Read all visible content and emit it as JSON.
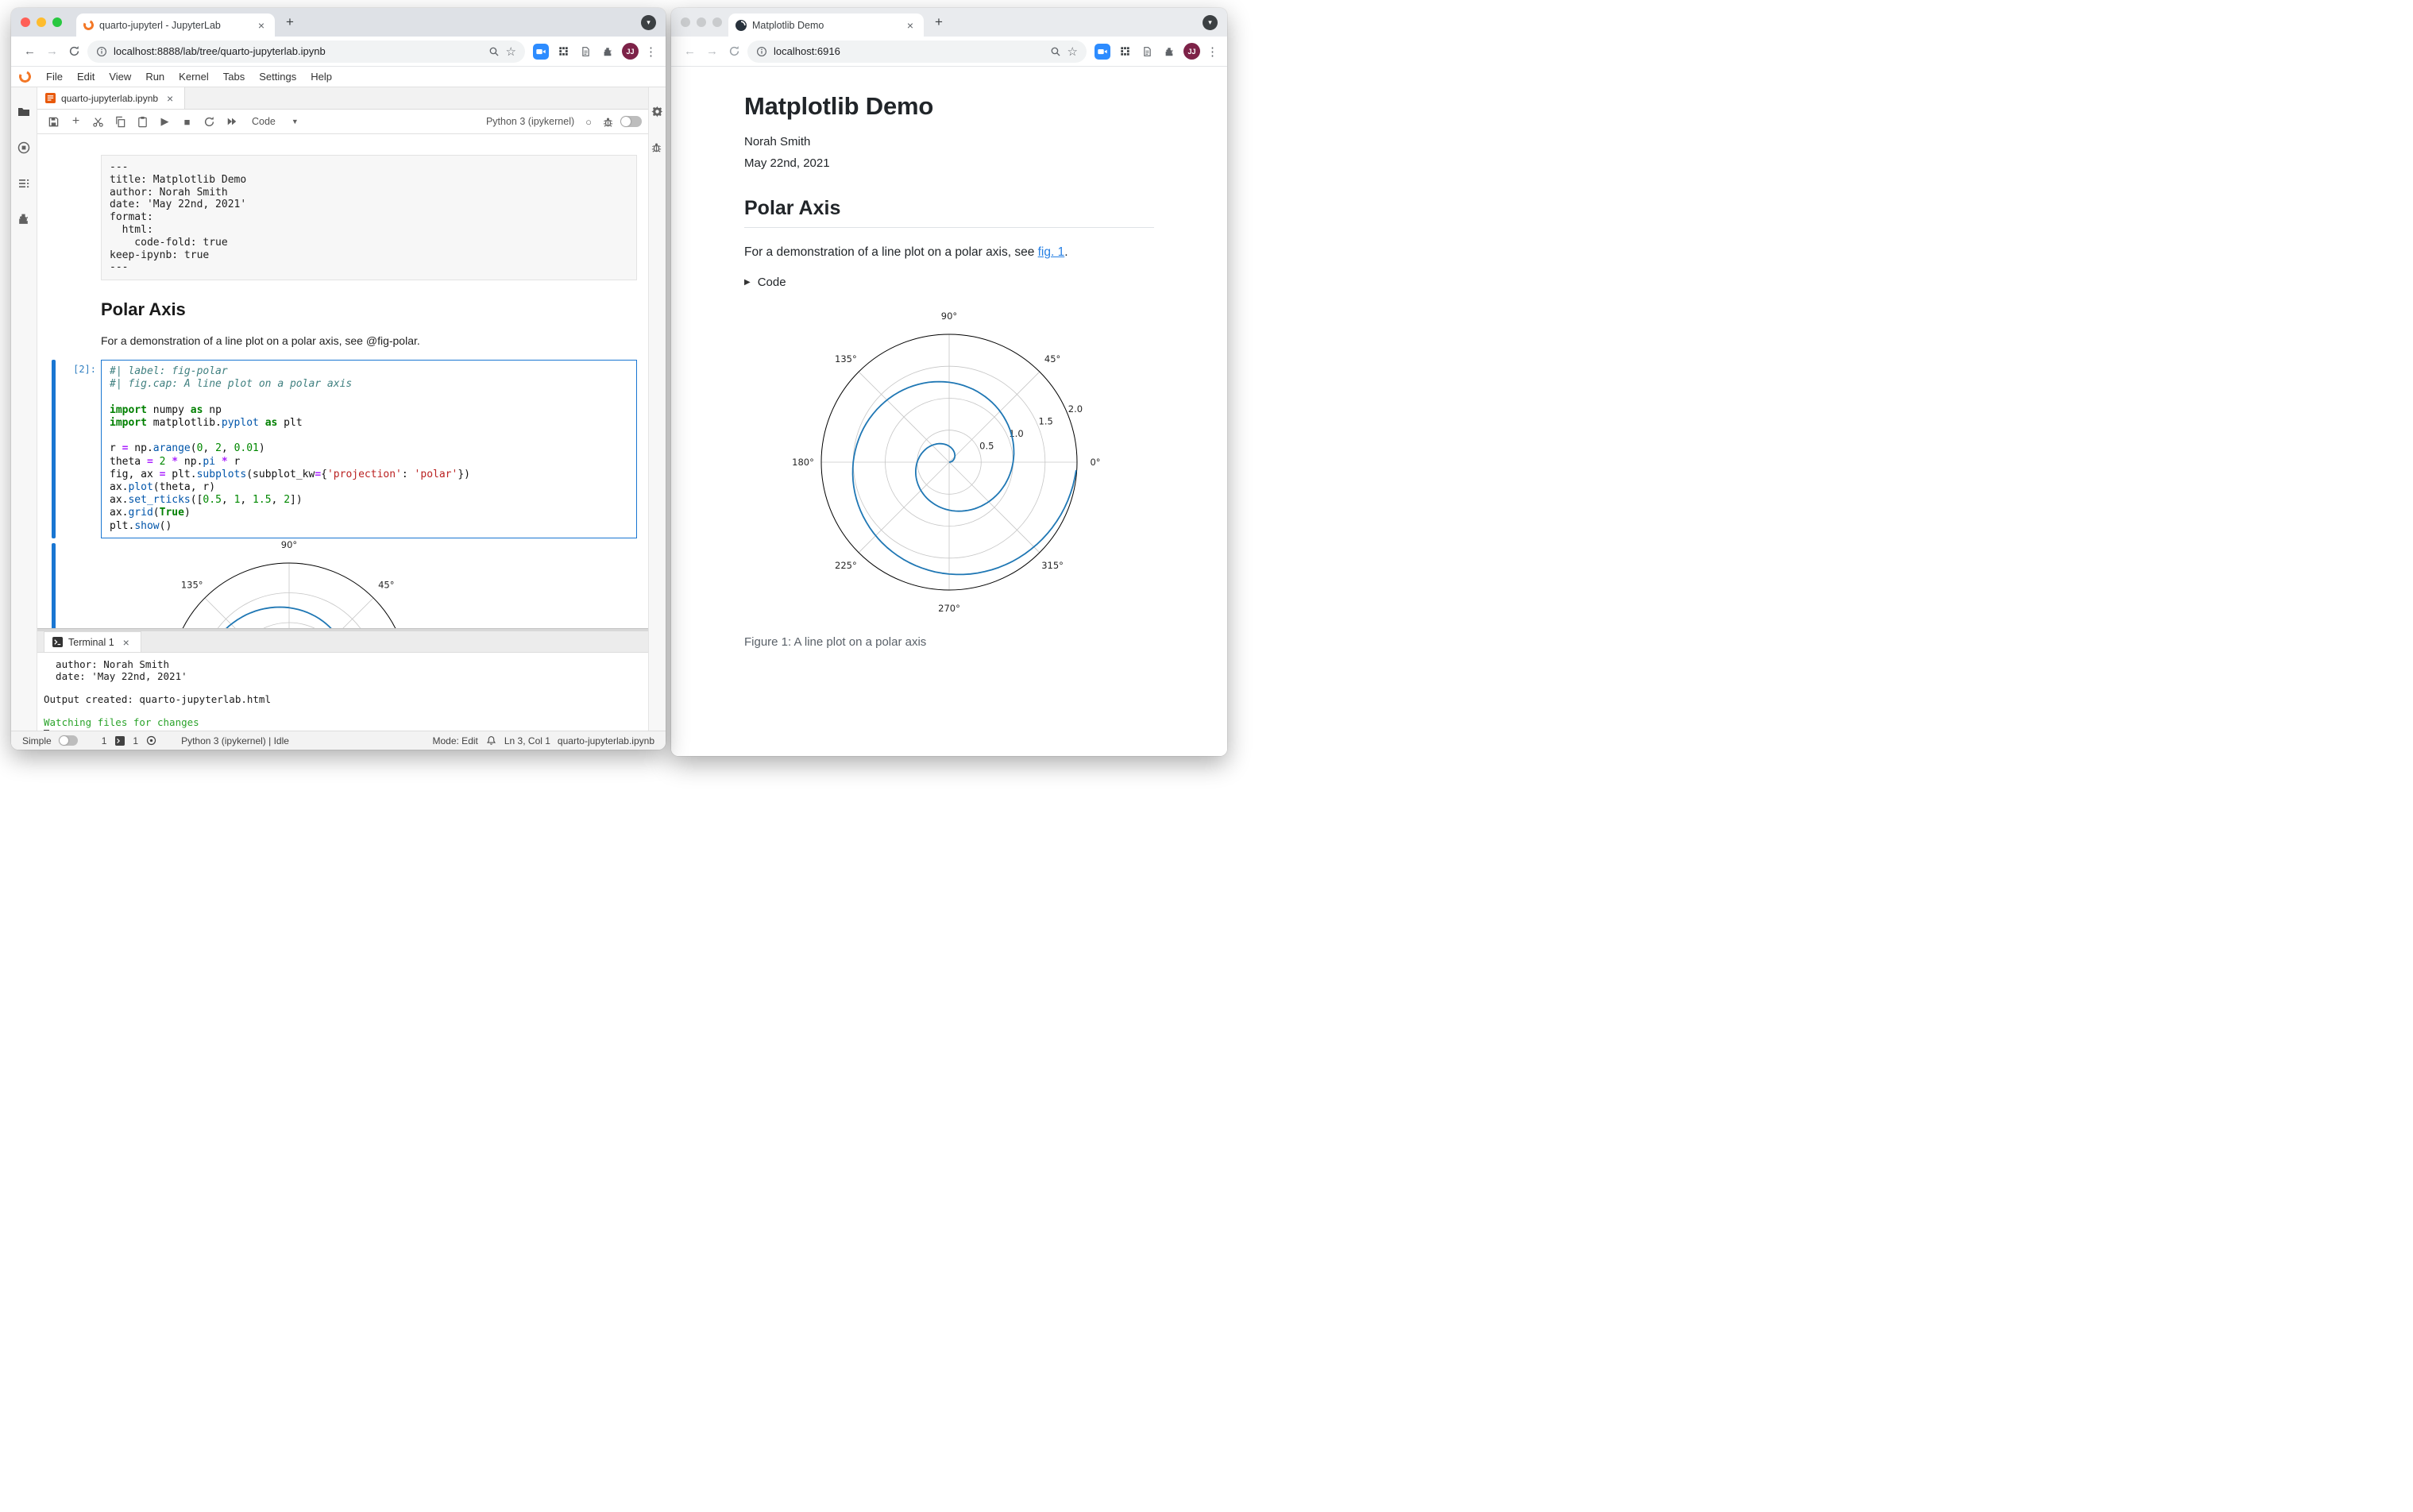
{
  "colors": {
    "jupyter_orange": "#f37726",
    "matplotlib_line_blue": "#1f77b4",
    "active_cell_border_blue": "#1976d2",
    "prompt_blue": "#307fc1",
    "link_blue": "#2780e3",
    "terminal_green": "#2aa32a",
    "avatar_maroon": "#7d2248",
    "zoom_extension_blue": "#2d8cff",
    "traffic_red": "#ff5f57",
    "traffic_yellow": "#febc2e",
    "traffic_green": "#28c840"
  },
  "left_window": {
    "browser": {
      "tab_title": "quarto-jupyterl - JupyterLab",
      "url": "localhost:8888/lab/tree/quarto-jupyterlab.ipynb",
      "new_tab_label": "+",
      "avatar_initials": "JJ"
    },
    "jupyterlab": {
      "menu": [
        "File",
        "Edit",
        "View",
        "Run",
        "Kernel",
        "Tabs",
        "Settings",
        "Help"
      ],
      "document_tab": "quarto-jupyterlab.ipynb",
      "toolbar": {
        "cell_type_selector": "Code",
        "kernel_name": "Python 3 (ipykernel)"
      },
      "raw_cell": {
        "lines": [
          "---",
          "title: Matplotlib Demo",
          "author: Norah Smith",
          "date: 'May 22nd, 2021'",
          "format:",
          "  html:",
          "    code-fold: true",
          "keep-ipynb: true",
          "---"
        ]
      },
      "markdown_cell": {
        "heading": "Polar Axis",
        "paragraph": "For a demonstration of a line plot on a polar axis, see @fig-polar."
      },
      "code_cell": {
        "prompt": "[2]:",
        "token_lines": [
          [
            [
              "c",
              "#| label: fig-polar"
            ]
          ],
          [
            [
              "c",
              "#| fig.cap: A line plot on a polar axis"
            ]
          ],
          [],
          [
            [
              "k",
              "import"
            ],
            [
              "p",
              " numpy "
            ],
            [
              "k",
              "as"
            ],
            [
              "p",
              " np"
            ]
          ],
          [
            [
              "k",
              "import"
            ],
            [
              "p",
              " matplotlib."
            ],
            [
              "f",
              "pyplot"
            ],
            [
              "p",
              " "
            ],
            [
              "k",
              "as"
            ],
            [
              "p",
              " plt"
            ]
          ],
          [],
          [
            [
              "p",
              "r "
            ],
            [
              "o",
              "="
            ],
            [
              "p",
              " np."
            ],
            [
              "f",
              "arange"
            ],
            [
              "p",
              "("
            ],
            [
              "n",
              "0"
            ],
            [
              "p",
              ", "
            ],
            [
              "n",
              "2"
            ],
            [
              "p",
              ", "
            ],
            [
              "n",
              "0.01"
            ],
            [
              "p",
              ")"
            ]
          ],
          [
            [
              "p",
              "theta "
            ],
            [
              "o",
              "="
            ],
            [
              "p",
              " "
            ],
            [
              "n",
              "2"
            ],
            [
              "p",
              " "
            ],
            [
              "o",
              "*"
            ],
            [
              "p",
              " np."
            ],
            [
              "f",
              "pi"
            ],
            [
              "p",
              " "
            ],
            [
              "o",
              "*"
            ],
            [
              "p",
              " r"
            ]
          ],
          [
            [
              "p",
              "fig, ax "
            ],
            [
              "o",
              "="
            ],
            [
              "p",
              " plt."
            ],
            [
              "f",
              "subplots"
            ],
            [
              "p",
              "(subplot_kw"
            ],
            [
              "o",
              "="
            ],
            [
              "p",
              "{"
            ],
            [
              "s",
              "'projection'"
            ],
            [
              "p",
              ": "
            ],
            [
              "s",
              "'polar'"
            ],
            [
              "p",
              "})"
            ]
          ],
          [
            [
              "p",
              "ax."
            ],
            [
              "f",
              "plot"
            ],
            [
              "p",
              "(theta, r)"
            ]
          ],
          [
            [
              "p",
              "ax."
            ],
            [
              "f",
              "set_rticks"
            ],
            [
              "p",
              "(["
            ],
            [
              "n",
              "0.5"
            ],
            [
              "p",
              ", "
            ],
            [
              "n",
              "1"
            ],
            [
              "p",
              ", "
            ],
            [
              "n",
              "1.5"
            ],
            [
              "p",
              ", "
            ],
            [
              "n",
              "2"
            ],
            [
              "p",
              "])"
            ]
          ],
          [
            [
              "p",
              "ax."
            ],
            [
              "f",
              "grid"
            ],
            [
              "p",
              "("
            ],
            [
              "k",
              "True"
            ],
            [
              "p",
              ")"
            ]
          ],
          [
            [
              "p",
              "plt."
            ],
            [
              "f",
              "show"
            ],
            [
              "p",
              "()"
            ]
          ]
        ]
      },
      "terminal": {
        "tab_label": "Terminal 1",
        "lines": [
          {
            "text": "  author: Norah Smith"
          },
          {
            "text": "  date: 'May 22nd, 2021'"
          },
          {
            "text": ""
          },
          {
            "text": "Output created: quarto-jupyterlab.html"
          },
          {
            "text": ""
          },
          {
            "text": "Watching files for changes",
            "color": "green"
          }
        ]
      },
      "status_bar": {
        "mode_toggle_label": "Simple",
        "terminals_count": "1",
        "kernels_count": "1",
        "kernel_status": "Python 3 (ipykernel) | Idle",
        "mode": "Mode: Edit",
        "cursor_position": "Ln 3, Col 1",
        "file_name": "quarto-jupyterlab.ipynb"
      }
    }
  },
  "right_window": {
    "browser": {
      "tab_title": "Matplotlib Demo",
      "url": "localhost:6916",
      "new_tab_label": "+",
      "avatar_initials": "JJ"
    },
    "document": {
      "title": "Matplotlib Demo",
      "author": "Norah Smith",
      "date": "May 22nd, 2021",
      "section_heading": "Polar Axis",
      "paragraph_prefix": "For a demonstration of a line plot on a polar axis, see ",
      "figure_link": "fig. 1",
      "paragraph_suffix": ".",
      "code_fold_label": "Code",
      "figure_caption": "Figure 1: A line plot on a polar axis"
    }
  },
  "chart_data": {
    "type": "line",
    "projection": "polar",
    "description": "Archimedean spiral: theta = 2*pi*r for r in [0, 2) step 0.01",
    "series": [
      {
        "name": "spiral",
        "r_start": 0,
        "r_end": 2,
        "r_step": 0.01,
        "theta_formula": "theta = 2 * pi * r"
      }
    ],
    "rmax": 2.0,
    "rticks": [
      0.5,
      1.0,
      1.5,
      2.0
    ],
    "rtick_labels": [
      "0.5",
      "1.0",
      "1.5",
      "2.0"
    ],
    "theta_tick_labels": [
      "0°",
      "45°",
      "90°",
      "135°",
      "180°",
      "225°",
      "270°",
      "315°"
    ],
    "rlabel_angle_deg": 22.5,
    "grid": true,
    "line_color": "#1f77b4",
    "grid_color": "#c6c6c6",
    "spine_color": "#000000",
    "instances": [
      "jupyterlab-cell-output",
      "quarto-html-figure-1"
    ]
  }
}
